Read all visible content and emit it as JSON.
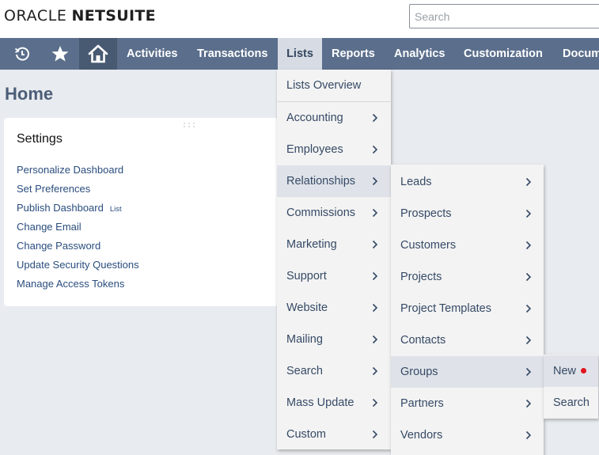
{
  "header": {
    "logo_oracle": "ORACLE",
    "logo_netsuite": "NETSUITE",
    "search_placeholder": "Search"
  },
  "nav": {
    "icons": [
      "recent-records-icon",
      "favorites-star-icon",
      "home-icon"
    ],
    "tabs": [
      "Activities",
      "Transactions",
      "Lists",
      "Reports",
      "Analytics",
      "Customization",
      "Docum"
    ],
    "active_tab": "Lists"
  },
  "page": {
    "title": "Home"
  },
  "settings": {
    "title": "Settings",
    "links": [
      "Personalize Dashboard",
      "Set Preferences",
      "Publish Dashboard",
      "Change Email",
      "Change Password",
      "Update Security Questions",
      "Manage Access Tokens"
    ],
    "publish_extra": "List"
  },
  "lists_menu": {
    "items": [
      "Lists Overview",
      "Accounting",
      "Employees",
      "Relationships",
      "Commissions",
      "Marketing",
      "Support",
      "Website",
      "Mailing",
      "Search",
      "Mass Update",
      "Custom"
    ],
    "highlighted": "Relationships"
  },
  "relationships_menu": {
    "items": [
      "Leads",
      "Prospects",
      "Customers",
      "Projects",
      "Project Templates",
      "Contacts",
      "Groups",
      "Partners",
      "Vendors"
    ],
    "highlighted": "Groups"
  },
  "groups_menu": {
    "items": [
      "New",
      "Search"
    ],
    "highlighted": "New"
  },
  "colors": {
    "nav_bg": "#5b6f8c",
    "nav_active_bg": "#d7dce4",
    "page_bg": "#e8ebef",
    "link": "#2a4d7e",
    "menu_text": "#364a66",
    "new_dot": "#e0141e"
  }
}
